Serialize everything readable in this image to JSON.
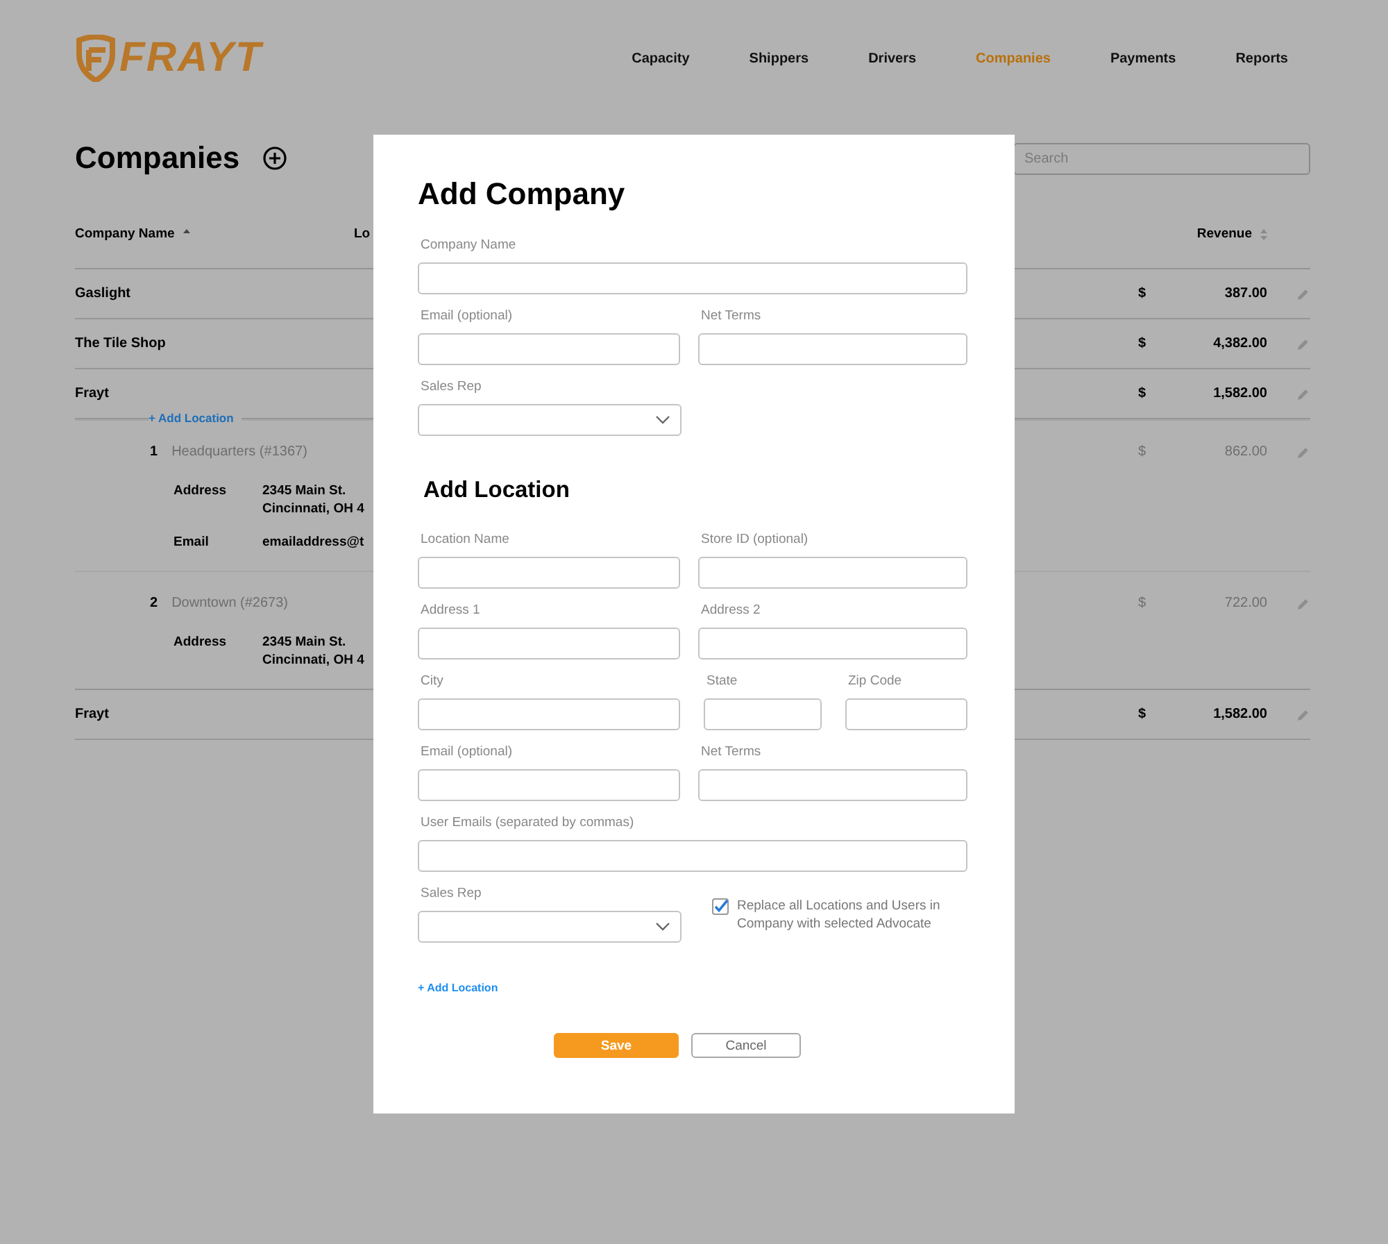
{
  "header": {
    "logo": "FRAYT",
    "nav": [
      {
        "label": "Capacity",
        "selected": false
      },
      {
        "label": "Shippers",
        "selected": false
      },
      {
        "label": "Drivers",
        "selected": false
      },
      {
        "label": "Companies",
        "selected": true
      },
      {
        "label": "Payments",
        "selected": false
      },
      {
        "label": "Reports",
        "selected": false
      }
    ]
  },
  "page": {
    "title": "Companies",
    "search": {
      "placeholder": "Search"
    }
  },
  "table": {
    "columns": [
      {
        "label": "Company Name",
        "sorted": true
      },
      {
        "label": "Lo"
      },
      {
        "label": "Revenue",
        "sorted": false
      }
    ],
    "rows": [
      {
        "kind": "company",
        "name": "Gaslight",
        "currency": "$",
        "revenue": "387.00"
      },
      {
        "kind": "company",
        "name": "The Tile Shop",
        "currency": "$",
        "revenue": "4,382.00"
      },
      {
        "kind": "company",
        "name": "Frayt",
        "currency": "$",
        "revenue": "1,582.00"
      },
      {
        "kind": "add_link",
        "label": "+ Add Location"
      },
      {
        "kind": "location",
        "number": "1",
        "name": "Headquarters (#1367)",
        "currency": "$",
        "revenue": "862.00",
        "details": [
          {
            "label": "Address",
            "lines": [
              "2345 Main St.",
              "Cincinnati, OH 4"
            ]
          },
          {
            "label": "Email",
            "lines": [
              "emailaddress@t"
            ]
          }
        ]
      },
      {
        "kind": "location",
        "number": "2",
        "name": "Downtown (#2673)",
        "currency": "$",
        "revenue": "722.00",
        "details": [
          {
            "label": "Address",
            "lines": [
              "2345 Main St.",
              "Cincinnati, OH 4"
            ]
          }
        ]
      },
      {
        "kind": "company",
        "name": "Frayt",
        "currency": "$",
        "revenue": "1,582.00"
      }
    ]
  },
  "modal": {
    "title": "Add Company",
    "company_rows": [
      [
        {
          "kind": "text",
          "label": "Company Name"
        }
      ],
      [
        {
          "kind": "text",
          "label": "Email (optional)"
        },
        {
          "kind": "text",
          "label": "Net Terms"
        }
      ],
      [
        {
          "kind": "select",
          "label": "Sales Rep"
        }
      ]
    ],
    "location_heading": "Add Location",
    "location_rows": [
      [
        {
          "kind": "text",
          "label": "Location Name"
        },
        {
          "kind": "text",
          "label": "Store ID (optional)"
        }
      ],
      [
        {
          "kind": "text",
          "label": "Address 1"
        },
        {
          "kind": "text",
          "label": "Address 2"
        }
      ],
      [
        {
          "kind": "text",
          "label": "City"
        },
        {
          "kind": "text",
          "label": "State"
        },
        {
          "kind": "text",
          "label": "Zip Code"
        }
      ],
      [
        {
          "kind": "text",
          "label": "Email (optional)"
        },
        {
          "kind": "text",
          "label": "Net Terms"
        }
      ],
      [
        {
          "kind": "text",
          "label": "User Emails (separated by commas)"
        }
      ],
      [
        {
          "kind": "select",
          "label": "Sales Rep"
        },
        {
          "kind": "checkbox",
          "label": "Replace all Locations and Users in Company with selected Advocate",
          "checked": true
        }
      ]
    ],
    "add_link": "+ Add Location",
    "buttons": [
      {
        "label": "Save",
        "kind": "primary"
      },
      {
        "label": "Cancel",
        "kind": "secondary"
      }
    ]
  }
}
